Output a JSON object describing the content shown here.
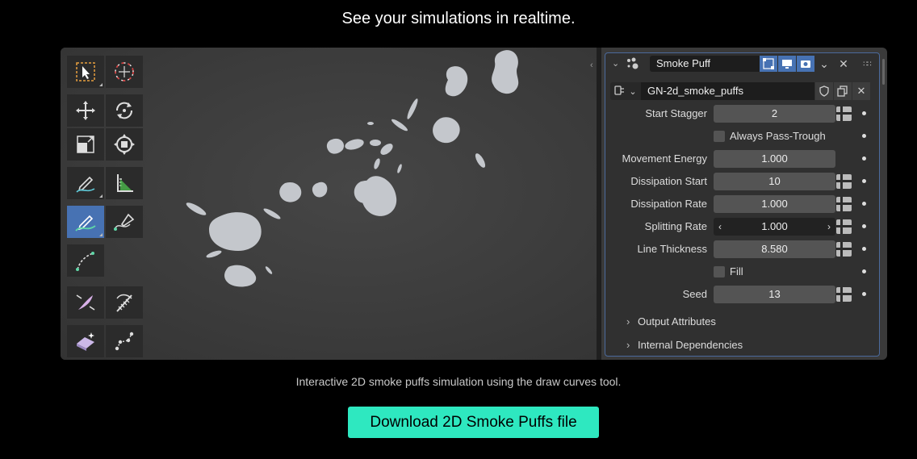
{
  "headline": "See your simulations in realtime.",
  "caption": "Interactive 2D smoke puffs simulation using the draw curves tool.",
  "download_button": "Download 2D Smoke Puffs file",
  "colors": {
    "accent_button": "#2ee8c0",
    "active_tool": "#4772b3",
    "panel_bg": "#303030",
    "viewport_bg": "#404040",
    "puff": "#c4c7cc"
  },
  "toolbar": {
    "tools": [
      {
        "icon": "select-box-icon",
        "active": false
      },
      {
        "icon": "cursor-icon",
        "active": false
      },
      {
        "icon": "move-icon",
        "active": false
      },
      {
        "icon": "rotate-icon",
        "active": false
      },
      {
        "icon": "scale-icon",
        "active": false
      },
      {
        "icon": "transform-icon",
        "active": false
      },
      {
        "icon": "annotate-icon",
        "active": false
      },
      {
        "icon": "measure-icon",
        "active": false
      },
      {
        "icon": "draw-curve-icon",
        "active": true
      },
      {
        "icon": "pen-icon",
        "active": false
      },
      {
        "icon": "curve-tilt-icon",
        "active": false
      },
      {
        "icon": "pinch-icon",
        "active": false
      },
      {
        "icon": "comb-icon",
        "active": false
      },
      {
        "icon": "erase-icon",
        "active": false
      },
      {
        "icon": "vertex-icon",
        "active": false
      }
    ]
  },
  "panel": {
    "modifier_name": "Smoke Puff",
    "node_group": "GN-2d_smoke_puffs",
    "properties": [
      {
        "label": "Start Stagger",
        "value": "2"
      },
      {
        "label": "Always Pass-Trough",
        "type": "checkbox"
      },
      {
        "label": "Movement Energy",
        "value": "1.000"
      },
      {
        "label": "Dissipation Start",
        "value": "10"
      },
      {
        "label": "Dissipation Rate",
        "value": "1.000"
      },
      {
        "label": "Splitting Rate",
        "value": "1.000"
      },
      {
        "label": "Line Thickness",
        "value": "8.580"
      },
      {
        "label": "Fill",
        "type": "checkbox"
      },
      {
        "label": "Seed",
        "value": "13"
      }
    ],
    "sections": [
      "Output Attributes",
      "Internal Dependencies"
    ]
  }
}
